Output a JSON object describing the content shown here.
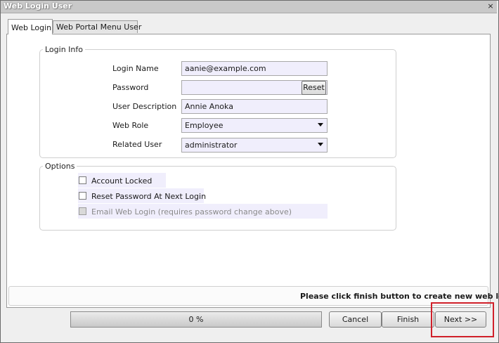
{
  "window": {
    "title": "Web Login User",
    "close_glyph": "×"
  },
  "tabs": [
    {
      "label": "Web Login",
      "active": true
    },
    {
      "label": "Web Portal Menu User",
      "active": false
    }
  ],
  "login_info": {
    "legend": "Login Info",
    "login_name": {
      "label": "Login Name",
      "value": "aanie@example.com"
    },
    "password": {
      "label": "Password",
      "value": "",
      "reset_label": "Reset"
    },
    "user_description": {
      "label": "User Description",
      "value": "Annie Anoka"
    },
    "web_role": {
      "label": "Web Role",
      "value": "Employee"
    },
    "related_user": {
      "label": "Related User",
      "value": "administrator"
    }
  },
  "options": {
    "legend": "Options",
    "account_locked": {
      "label": "Account Locked",
      "checked": false,
      "enabled": true
    },
    "reset_password": {
      "label": "Reset Password At Next Login",
      "checked": false,
      "enabled": true
    },
    "email_web_login": {
      "label": "Email Web Login (requires password change above)",
      "checked": false,
      "enabled": false
    }
  },
  "status": {
    "message": "Please click finish button to create new web login."
  },
  "footer": {
    "progress_text": "0 %",
    "progress_value": 0,
    "cancel_label": "Cancel",
    "finish_label": "Finish",
    "next_label": "Next >>"
  },
  "colors": {
    "field_bg": "#f0eefc",
    "highlight": "#d0202a"
  }
}
